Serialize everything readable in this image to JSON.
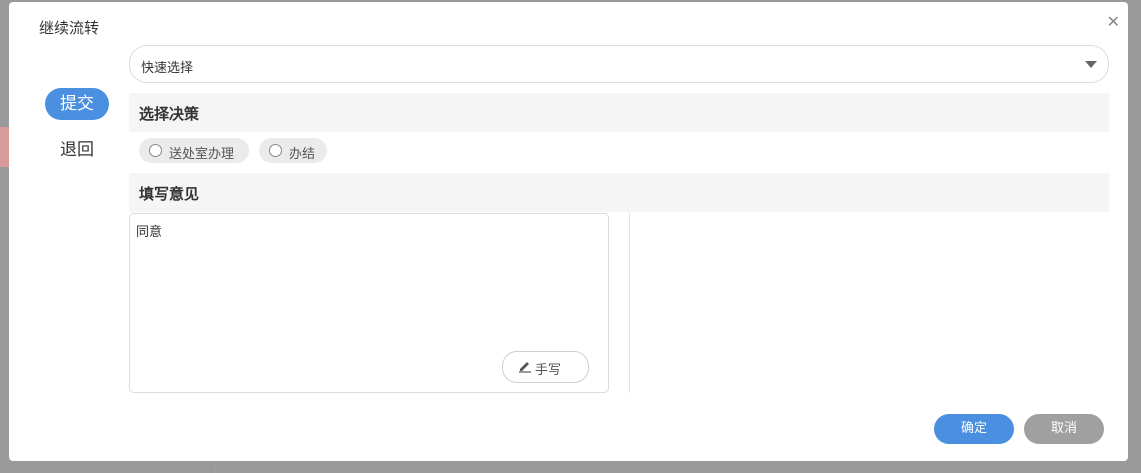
{
  "dialog": {
    "title": "继续流转",
    "close_symbol": "✕"
  },
  "quick_select": {
    "value": "快速选择"
  },
  "mode_tabs": [
    {
      "label": "提交",
      "active": true
    },
    {
      "label": "退回",
      "active": false
    }
  ],
  "decision": {
    "header": "选择决策",
    "options": [
      {
        "label": "送处室办理",
        "checked": false
      },
      {
        "label": "办结",
        "checked": false
      }
    ]
  },
  "opinion": {
    "header": "填写意见",
    "text": "同意",
    "handwrite_label": "手写"
  },
  "footer": {
    "ok_label": "确定",
    "cancel_label": "取消"
  },
  "colors": {
    "primary": "#4a8fe0",
    "secondary_button": "#a0a0a0",
    "section_header_bg": "#f5f5f5"
  }
}
